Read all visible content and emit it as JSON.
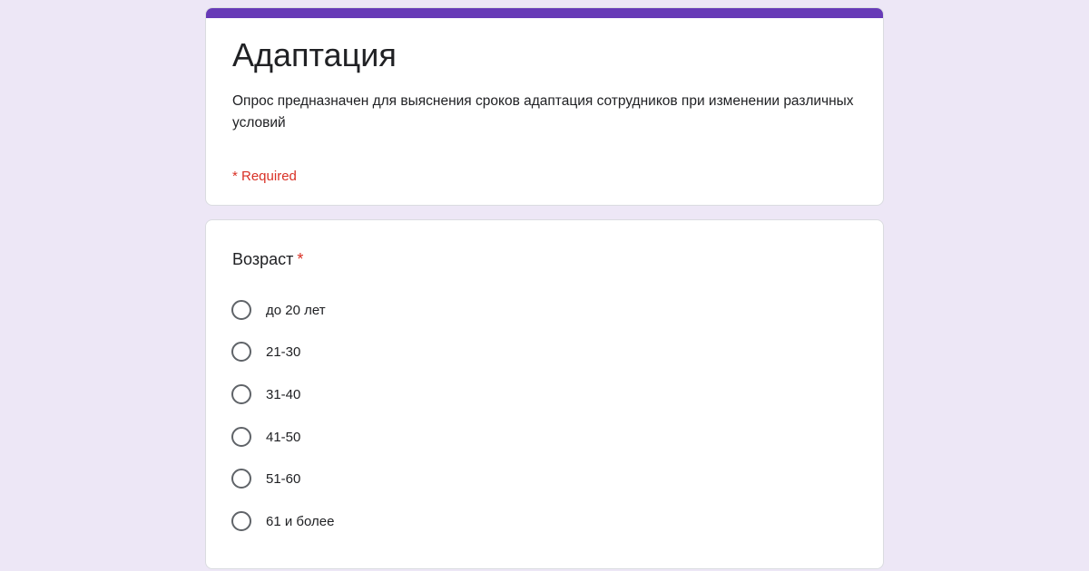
{
  "form": {
    "title": "Адаптация",
    "description": "Опрос предназначен для выяснения сроков адаптация сотрудников при изменении различных условий",
    "required_note": "* Required"
  },
  "question": {
    "title": "Возраст",
    "required_marker": "*",
    "options": [
      {
        "label": "до 20 лет",
        "selected": false
      },
      {
        "label": "21-30",
        "selected": false
      },
      {
        "label": "31-40",
        "selected": false
      },
      {
        "label": "41-50",
        "selected": false
      },
      {
        "label": "51-60",
        "selected": false
      },
      {
        "label": "61 и более",
        "selected": false
      }
    ]
  },
  "colors": {
    "accent": "#673ab7",
    "page_background": "#ede7f6",
    "required": "#d93025"
  }
}
